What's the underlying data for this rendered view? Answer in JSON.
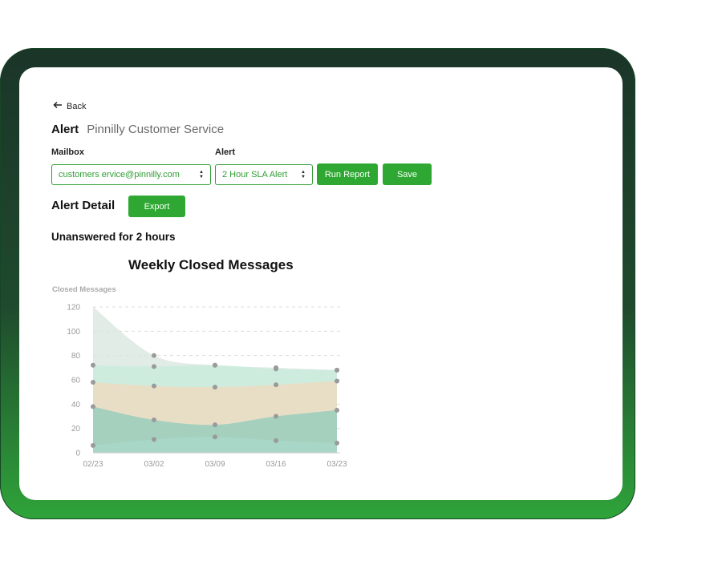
{
  "nav": {
    "back_label": "Back"
  },
  "header": {
    "label": "Alert",
    "value": "Pinnilly Customer Service"
  },
  "form": {
    "mailbox_label": "Mailbox",
    "mailbox_value": "customers ervice@pinnilly.com",
    "alert_label": "Alert",
    "alert_value": "2 Hour SLA Alert",
    "run_report_label": "Run Report",
    "save_label": "Save"
  },
  "detail": {
    "title": "Alert Detail",
    "export_label": "Export",
    "condition": "Unanswered for 2 hours"
  },
  "colors": {
    "accent": "#2ea832"
  },
  "chart_data": {
    "type": "area",
    "title": "Weekly Closed Messages",
    "ylabel": "Closed Messages",
    "xlabel": "",
    "ylim": [
      0,
      120
    ],
    "yticks": [
      0,
      20,
      40,
      60,
      80,
      100,
      120
    ],
    "x": [
      "02/23",
      "03/02",
      "03/09",
      "03/16",
      "03/23"
    ],
    "grid": "horizontal-dashed",
    "series": [
      {
        "color": "#d8e6de",
        "values": [
          120,
          80,
          72,
          70,
          68
        ]
      },
      {
        "color": "#c5ecdb",
        "values": [
          72,
          71,
          72,
          69,
          68
        ]
      },
      {
        "color": "#f0d9bd",
        "values": [
          58,
          55,
          54,
          56,
          59
        ]
      },
      {
        "color": "#8fcbbb",
        "values": [
          38,
          27,
          23,
          30,
          35
        ]
      },
      {
        "color": "#a9d9ca",
        "values": [
          6,
          11,
          13,
          10,
          8
        ]
      }
    ]
  }
}
